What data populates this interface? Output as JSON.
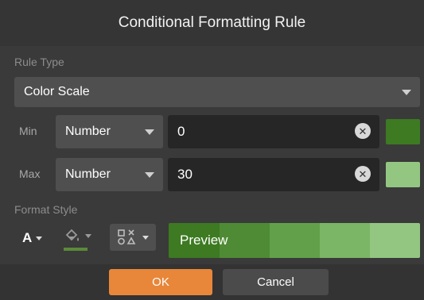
{
  "dialog": {
    "title": "Conditional Formatting Rule"
  },
  "rule_type": {
    "label": "Rule Type",
    "value": "Color Scale"
  },
  "min": {
    "label": "Min",
    "type": "Number",
    "value": "0",
    "color": "#3d7a22"
  },
  "max": {
    "label": "Max",
    "type": "Number",
    "value": "30",
    "color": "#93c781"
  },
  "format_style": {
    "label": "Format Style",
    "font_color_glyph": "A",
    "fill_color_underline": "#5a8a3a",
    "preview_text": "Preview",
    "preview_colors": [
      "#3d7a22",
      "#4f8b35",
      "#62a14a",
      "#7ab665",
      "#93c781"
    ]
  },
  "buttons": {
    "ok": "OK",
    "cancel": "Cancel"
  },
  "colors": {
    "ok_accent": "#e8873a",
    "cancel_bg": "#4b4b4b"
  }
}
